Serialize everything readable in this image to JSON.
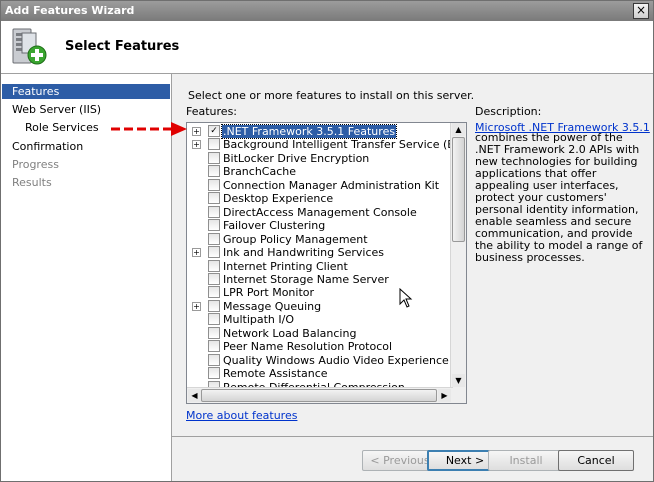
{
  "window": {
    "title": "Add Features Wizard",
    "close_glyph": "×"
  },
  "header": {
    "heading": "Select Features",
    "icon": "server-add-icon"
  },
  "sidebar": {
    "items": [
      {
        "label": "Features",
        "state": "selected"
      },
      {
        "label": "Web Server (IIS)",
        "state": "normal"
      },
      {
        "label": "Role Services",
        "state": "normal"
      },
      {
        "label": "Confirmation",
        "state": "normal"
      },
      {
        "label": "Progress",
        "state": "disabled"
      },
      {
        "label": "Results",
        "state": "disabled"
      }
    ]
  },
  "main": {
    "instruction": "Select one or more features to install on this server.",
    "features_label": "Features:",
    "features": [
      {
        "label": ".NET Framework 3.5.1 Features",
        "expandable": true,
        "checked": true,
        "selected": true
      },
      {
        "label": "Background Intelligent Transfer Service (BITS)",
        "expandable": true,
        "checked": false
      },
      {
        "label": "BitLocker Drive Encryption",
        "expandable": false,
        "checked": false
      },
      {
        "label": "BranchCache",
        "expandable": false,
        "checked": false
      },
      {
        "label": "Connection Manager Administration Kit",
        "expandable": false,
        "checked": false
      },
      {
        "label": "Desktop Experience",
        "expandable": false,
        "checked": false
      },
      {
        "label": "DirectAccess Management Console",
        "expandable": false,
        "checked": false
      },
      {
        "label": "Failover Clustering",
        "expandable": false,
        "checked": false
      },
      {
        "label": "Group Policy Management",
        "expandable": false,
        "checked": false
      },
      {
        "label": "Ink and Handwriting Services",
        "expandable": true,
        "checked": false
      },
      {
        "label": "Internet Printing Client",
        "expandable": false,
        "checked": false
      },
      {
        "label": "Internet Storage Name Server",
        "expandable": false,
        "checked": false
      },
      {
        "label": "LPR Port Monitor",
        "expandable": false,
        "checked": false
      },
      {
        "label": "Message Queuing",
        "expandable": true,
        "checked": false
      },
      {
        "label": "Multipath I/O",
        "expandable": false,
        "checked": false
      },
      {
        "label": "Network Load Balancing",
        "expandable": false,
        "checked": false
      },
      {
        "label": "Peer Name Resolution Protocol",
        "expandable": false,
        "checked": false
      },
      {
        "label": "Quality Windows Audio Video Experience",
        "expandable": false,
        "checked": false
      },
      {
        "label": "Remote Assistance",
        "expandable": false,
        "checked": false
      },
      {
        "label": "Remote Differential Compression",
        "expandable": false,
        "checked": false
      }
    ],
    "description_label": "Description:",
    "description_link": "Microsoft .NET Framework 3.5.1",
    "description_text": "combines the power of the .NET Framework 2.0 APIs with new technologies for building applications that offer appealing user interfaces, protect your customers' personal identity information, enable seamless and secure communication, and provide the ability to model a range of business processes.",
    "more_link": "More about features"
  },
  "buttons": {
    "previous": "< Previous",
    "next": "Next >",
    "install": "Install",
    "cancel": "Cancel"
  },
  "colors": {
    "selection": "#2d5da6",
    "link": "#0033cc",
    "annotation_arrow": "#e00000"
  }
}
